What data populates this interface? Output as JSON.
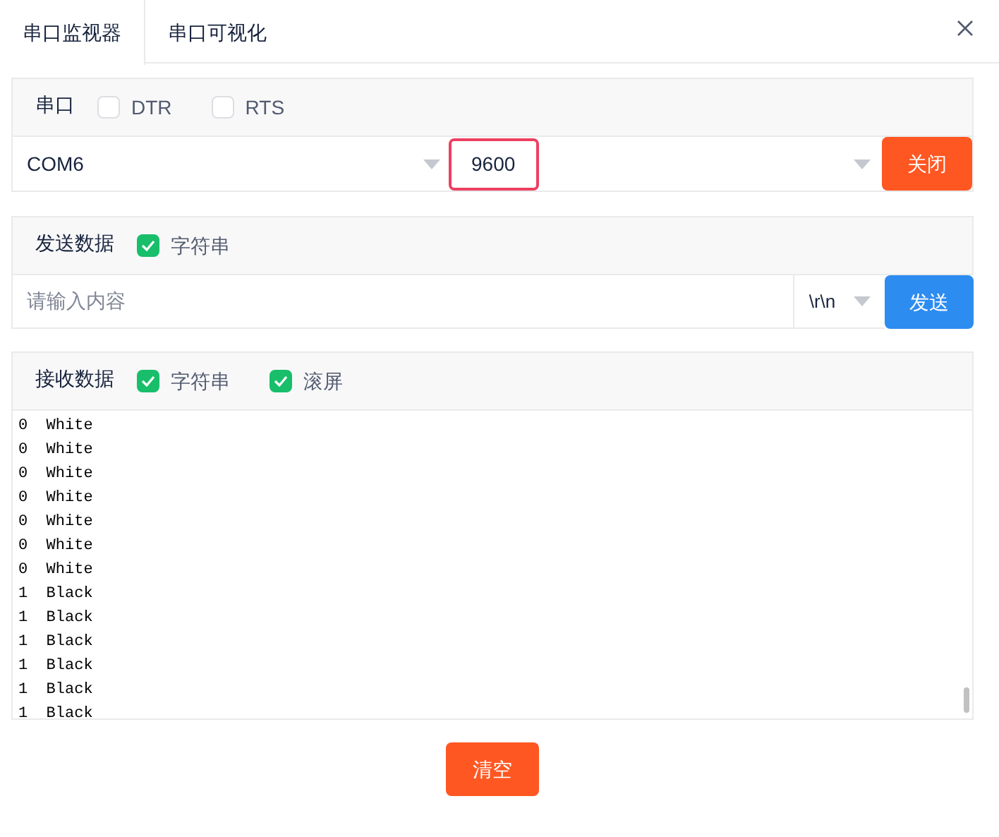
{
  "tabs": [
    {
      "label": "串口监视器",
      "selected": true
    },
    {
      "label": "串口可视化",
      "selected": false
    }
  ],
  "serial": {
    "label": "串口",
    "options": [
      {
        "label": "DTR",
        "checked": false
      },
      {
        "label": "RTS",
        "checked": false
      }
    ],
    "port": "COM6",
    "baud": "9600",
    "baud_highlighted": true,
    "button": "关闭"
  },
  "send": {
    "label": "发送数据",
    "options": [
      {
        "label": "字符串",
        "checked": true
      }
    ],
    "placeholder": "请输入内容",
    "ending": "\\r\\n",
    "button": "发送"
  },
  "receive": {
    "label": "接收数据",
    "options": [
      {
        "label": "字符串",
        "checked": true
      },
      {
        "label": "滚屏",
        "checked": true
      }
    ],
    "lines": [
      "0  White",
      "0  White",
      "0  White",
      "0  White",
      "0  White",
      "0  White",
      "0  White",
      "1  Black",
      "1  Black",
      "1  Black",
      "1  Black",
      "1  Black",
      "1  Black"
    ]
  },
  "clear_button": "清空"
}
